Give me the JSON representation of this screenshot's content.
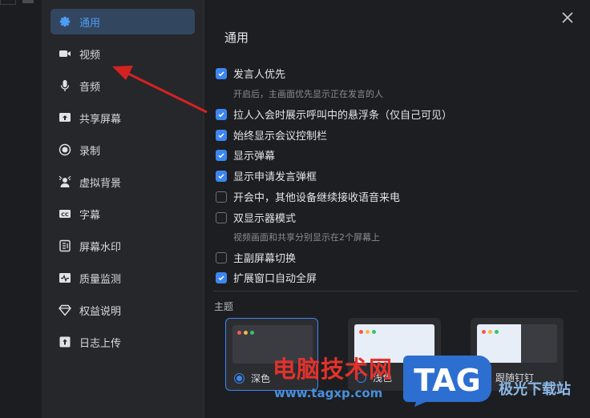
{
  "sidebar": {
    "items": [
      {
        "label": "通用",
        "icon": "gear-icon",
        "active": true
      },
      {
        "label": "视频",
        "icon": "video-camera-icon"
      },
      {
        "label": "音频",
        "icon": "microphone-icon"
      },
      {
        "label": "共享屏幕",
        "icon": "share-screen-icon"
      },
      {
        "label": "录制",
        "icon": "record-icon"
      },
      {
        "label": "虚拟背景",
        "icon": "virtual-background-icon"
      },
      {
        "label": "字幕",
        "icon": "captions-icon"
      },
      {
        "label": "屏幕水印",
        "icon": "watermark-icon"
      },
      {
        "label": "质量监测",
        "icon": "quality-monitor-icon"
      },
      {
        "label": "权益说明",
        "icon": "diamond-icon"
      },
      {
        "label": "日志上传",
        "icon": "upload-log-icon"
      }
    ]
  },
  "main": {
    "title": "通用",
    "options": [
      {
        "label": "发言人优先",
        "checked": true
      },
      {
        "label": "拉人入会时展示呼叫中的悬浮条（仅自己可见）",
        "checked": true
      },
      {
        "label": "始终显示会议控制栏",
        "checked": true
      },
      {
        "label": "显示弹幕",
        "checked": true
      },
      {
        "label": "显示申请发言弹框",
        "checked": true
      },
      {
        "label": "开会中，其他设备继续接收语音来电",
        "checked": false
      },
      {
        "label": "双显示器模式",
        "checked": false
      },
      {
        "label": "主副屏幕切换",
        "checked": false
      },
      {
        "label": "扩展窗口自动全屏",
        "checked": true
      }
    ],
    "hints": {
      "speaker_priority": "开启后，主画面优先显示正在发言的人",
      "dual_monitor": "视频画面和共享分别显示在2个屏幕上"
    },
    "theme": {
      "label": "主题",
      "options": [
        {
          "label": "深色",
          "selected": true
        },
        {
          "label": "浅色",
          "selected": false
        },
        {
          "label": "跟随钉钉",
          "selected": false
        }
      ]
    }
  },
  "watermark": {
    "site_name": "电脑技术网",
    "url": "www.tagxp.com",
    "tag": "TAG",
    "secondary": "极光下载站"
  },
  "colors": {
    "accent": "#3d86f2",
    "active_nav_bg": "#32465f",
    "annotation_arrow": "#d42222"
  }
}
